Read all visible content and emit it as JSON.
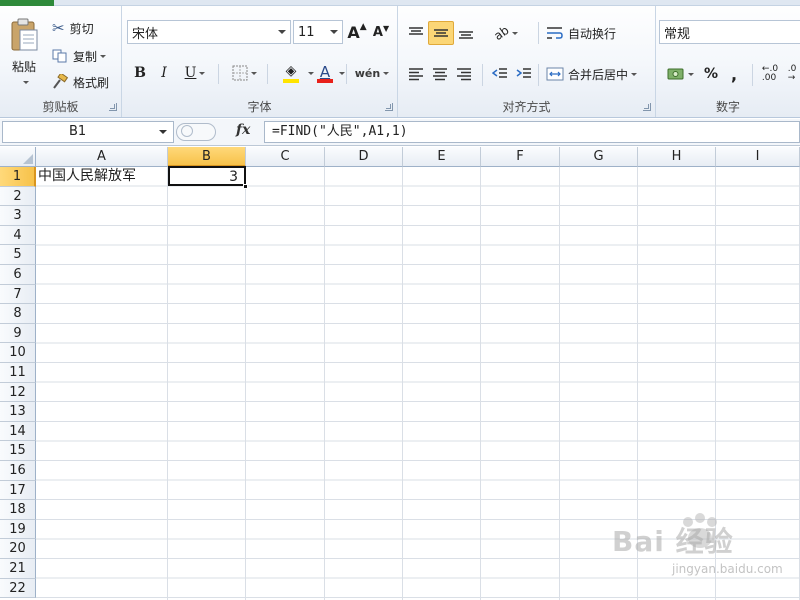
{
  "ribbon": {
    "clipboard": {
      "group_label": "剪贴板",
      "paste_label": "粘贴",
      "cut_label": "剪切",
      "copy_label": "复制",
      "format_painter_label": "格式刷"
    },
    "font": {
      "group_label": "字体",
      "font_name": "宋体",
      "font_size": "11",
      "bold": "B",
      "italic": "I",
      "underline": "U",
      "font_color_glyph": "A",
      "grow_glyph": "A",
      "shrink_glyph": "A",
      "phonetic_glyph": "wén"
    },
    "alignment": {
      "group_label": "对齐方式",
      "wrap_label": "自动换行",
      "merge_label": "合并后居中"
    },
    "number": {
      "group_label": "数字",
      "format": "常规",
      "percent": "%",
      "comma": ","
    },
    "colors": {
      "fill": "#ffe400",
      "font_color": "#e8201a",
      "selected_button": "#fbd676"
    }
  },
  "formula_bar": {
    "name_box": "B1",
    "fx": "fx",
    "formula": "=FIND(\"人民\",A1,1)"
  },
  "grid": {
    "columns": [
      "A",
      "B",
      "C",
      "D",
      "E",
      "F",
      "G",
      "H",
      "I"
    ],
    "rows": [
      "1",
      "2",
      "3",
      "4",
      "5",
      "6",
      "7",
      "8",
      "9",
      "10",
      "11",
      "12",
      "13",
      "14",
      "15",
      "16",
      "17",
      "18",
      "19",
      "20",
      "21",
      "22"
    ],
    "selected_column": "B",
    "selected_row": "1",
    "cells": {
      "A1": "中国人民解放军",
      "B1": "3"
    }
  },
  "watermark": {
    "text": "Bai  经验",
    "sub": "jingyan.baidu.com"
  }
}
